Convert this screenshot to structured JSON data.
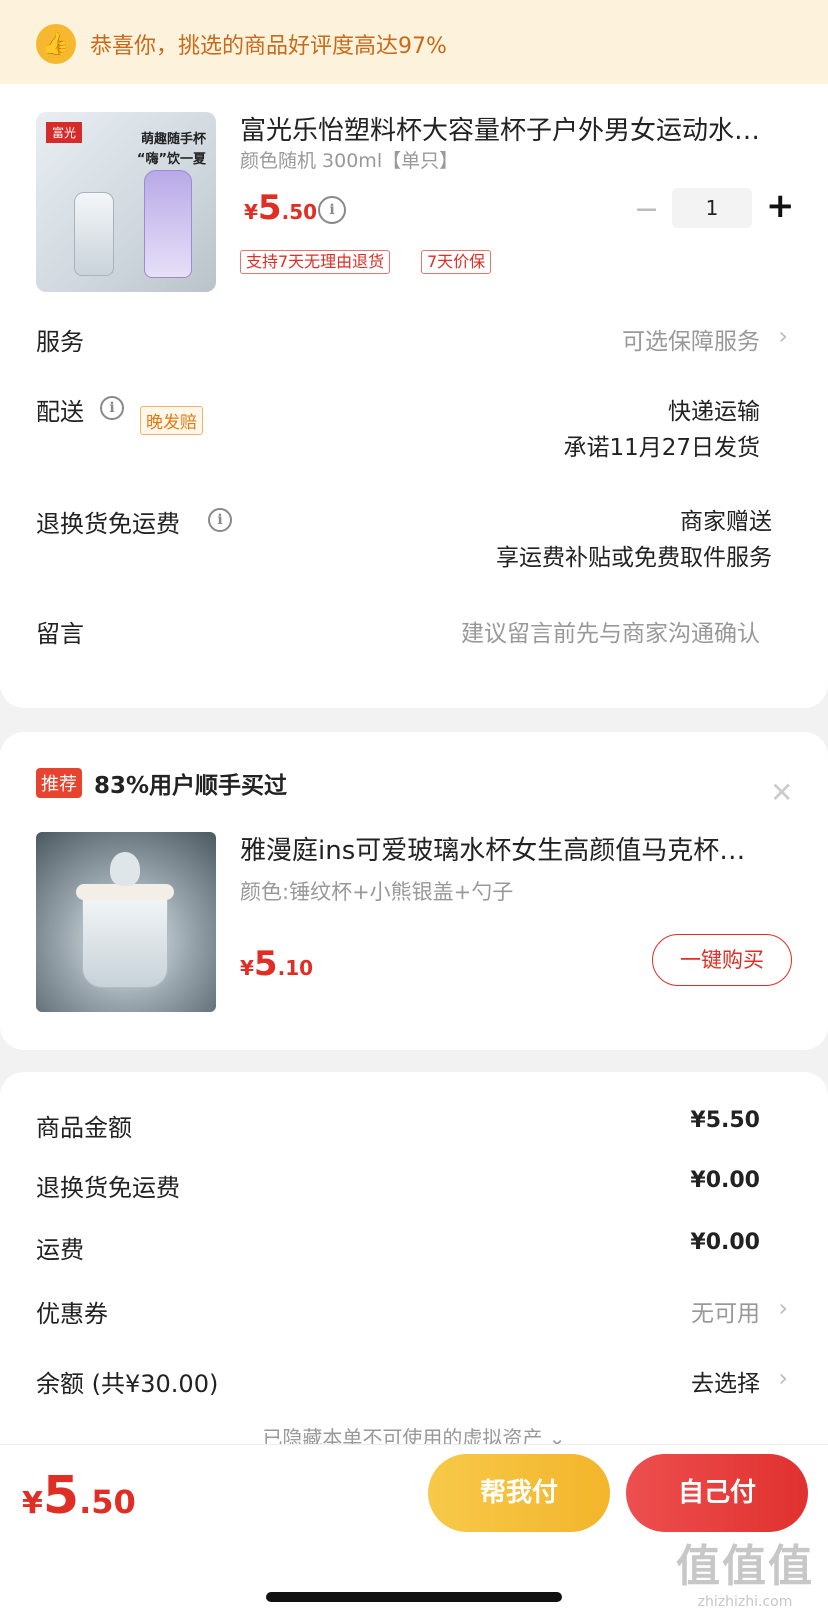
{
  "banner": {
    "icon": "thumbs-up-icon",
    "text": "恭喜你，挑选的商品好评度高达97%"
  },
  "product": {
    "image_tag": "富光",
    "image_caption_1": "萌趣随手杯",
    "image_caption_2": "“嗨”饮一夏",
    "title": "富光乐怡塑料杯大容量杯子户外男女运动水…",
    "spec": "颜色随机 300ml【单只】",
    "price": {
      "currency": "¥",
      "int": "5",
      "dec": ".50"
    },
    "quantity": "1",
    "minus": "−",
    "plus": "+",
    "tags": [
      "支持7天无理由退货",
      "7天价保"
    ]
  },
  "rows": {
    "service": {
      "label": "服务",
      "value": "可选保障服务"
    },
    "delivery": {
      "label": "配送",
      "badge": "晚发赔",
      "value1": "快递运输",
      "value2": "承诺11月27日发货"
    },
    "return_fee": {
      "label": "退换货免运费",
      "value1": "商家赠送",
      "value2": "享运费补贴或免费取件服务"
    },
    "message": {
      "label": "留言",
      "placeholder": "建议留言前先与商家沟通确认"
    }
  },
  "recommend": {
    "badge": "推荐",
    "text": "83%用户顺手买过",
    "title": "雅漫庭ins可爱玻璃水杯女生高颜值马克杯…",
    "spec": "颜色:锤纹杯+小熊银盖+勺子",
    "price": {
      "currency": "¥",
      "int": "5",
      "dec": ".10"
    },
    "buy_label": "一键购买"
  },
  "summary": {
    "goods_amount": {
      "label": "商品金额",
      "value": "¥5.50"
    },
    "return_fee": {
      "label": "退换货免运费",
      "value": "¥0.00"
    },
    "shipping": {
      "label": "运费",
      "value": "¥0.00"
    },
    "coupon": {
      "label": "优惠券",
      "value": "无可用"
    },
    "balance": {
      "label": "余额 (共¥30.00)",
      "value": "去选择"
    },
    "hidden_assets": "已隐藏本单不可使用的虚拟资产"
  },
  "footer": {
    "total": {
      "currency": "¥",
      "int": "5",
      "dec": ".50"
    },
    "help_pay": "帮我付",
    "self_pay": "自己付"
  },
  "watermark": {
    "big": "值值值",
    "small": "zhizhizhi.com"
  },
  "colors": {
    "accent": "#e02e24",
    "banner_bg": "#fdf3dc",
    "help_btn": "#f5bd35"
  }
}
